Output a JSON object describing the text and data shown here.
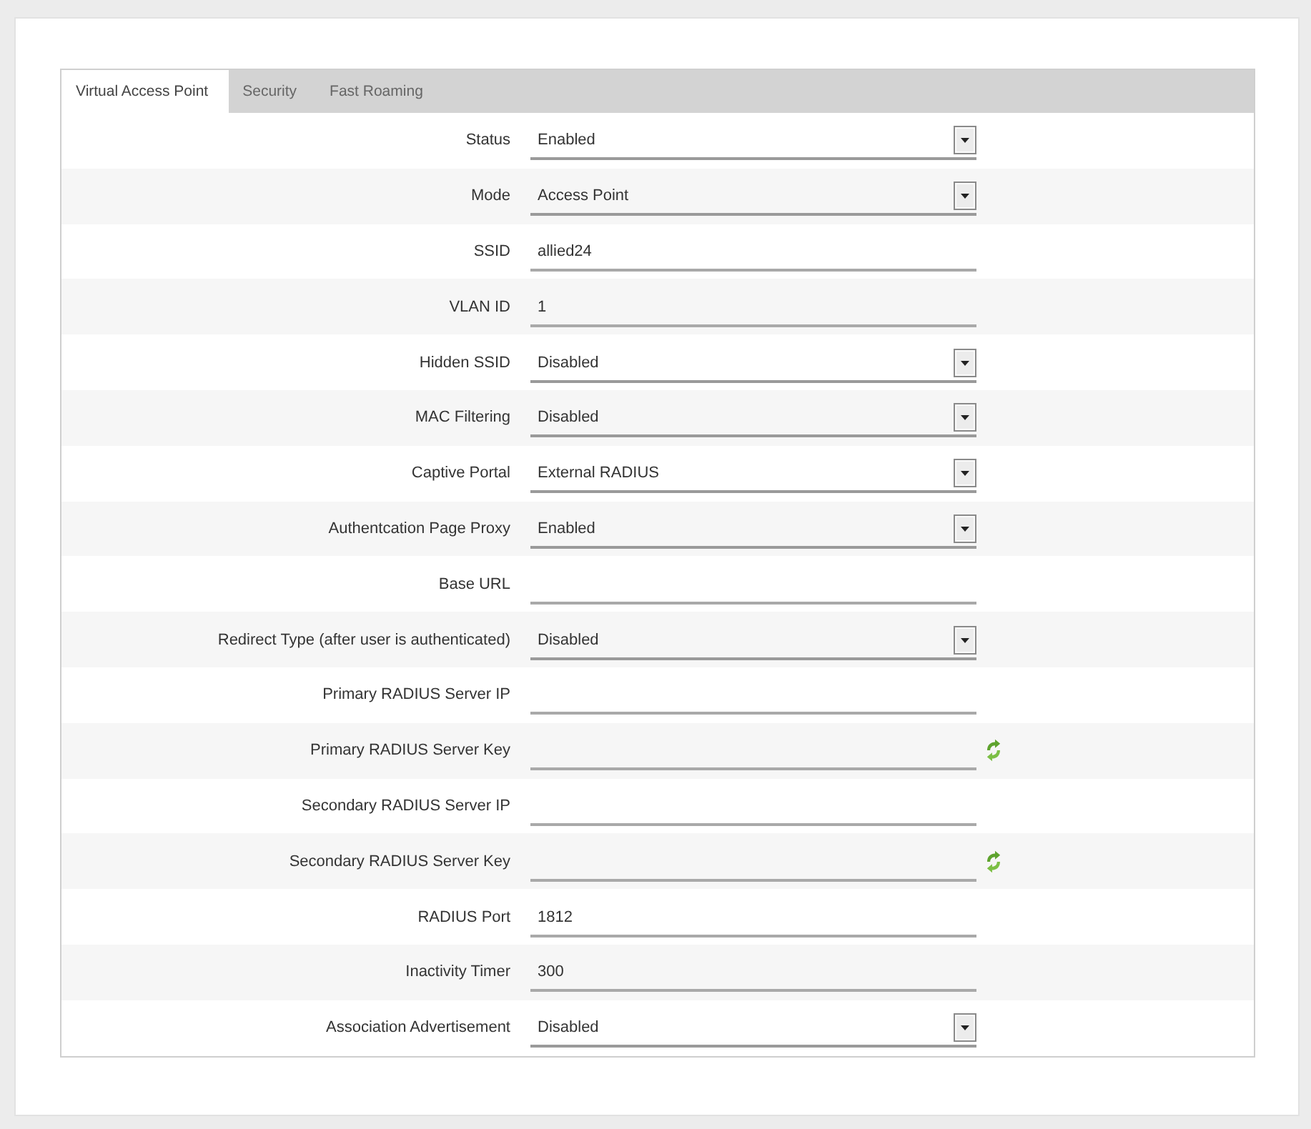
{
  "tabs": [
    {
      "label": "Virtual Access Point",
      "selected": true
    },
    {
      "label": "Security",
      "selected": false
    },
    {
      "label": "Fast Roaming",
      "selected": false
    }
  ],
  "fields": [
    {
      "label": "Status",
      "kind": "select",
      "value": "Enabled"
    },
    {
      "label": "Mode",
      "kind": "select",
      "value": "Access Point"
    },
    {
      "label": "SSID",
      "kind": "text",
      "value": "allied24"
    },
    {
      "label": "VLAN ID",
      "kind": "text",
      "value": "1"
    },
    {
      "label": "Hidden SSID",
      "kind": "select",
      "value": "Disabled"
    },
    {
      "label": "MAC Filtering",
      "kind": "select",
      "value": "Disabled"
    },
    {
      "label": "Captive Portal",
      "kind": "select",
      "value": "External RADIUS"
    },
    {
      "label": "Authentcation Page Proxy",
      "kind": "select",
      "value": "Enabled"
    },
    {
      "label": "Base URL",
      "kind": "text"
    },
    {
      "label": "Redirect Type (after user is authenticated)",
      "kind": "select",
      "value": "Disabled"
    },
    {
      "label": "Primary RADIUS Server IP",
      "kind": "text"
    },
    {
      "label": "Primary RADIUS Server Key",
      "kind": "key"
    },
    {
      "label": "Secondary RADIUS Server IP",
      "kind": "text"
    },
    {
      "label": "Secondary RADIUS Server Key",
      "kind": "key"
    },
    {
      "label": "RADIUS Port",
      "kind": "text",
      "value": "1812"
    },
    {
      "label": "Inactivity Timer",
      "kind": "text",
      "value": "300"
    },
    {
      "label": "Association Advertisement",
      "kind": "select",
      "value": "Disabled"
    }
  ]
}
